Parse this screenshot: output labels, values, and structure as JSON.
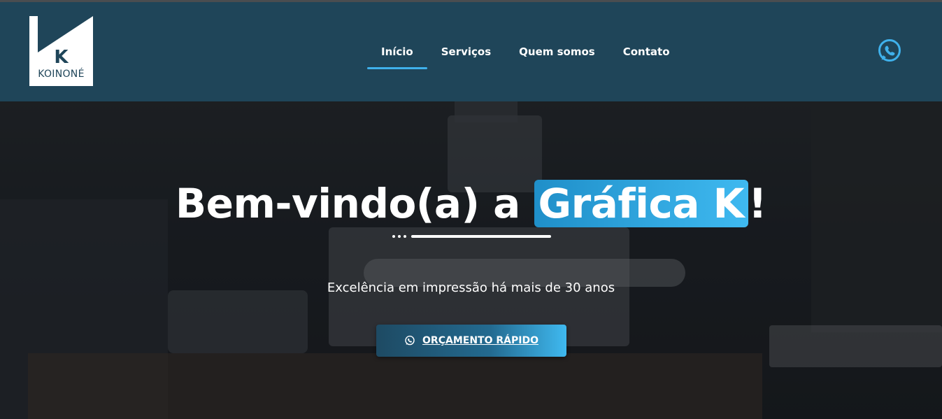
{
  "brand": {
    "logo_letter": "K",
    "logo_name": "KOINONÉ"
  },
  "nav": {
    "items": [
      {
        "label": "Início",
        "active": true
      },
      {
        "label": "Serviços",
        "active": false
      },
      {
        "label": "Quem somos",
        "active": false
      },
      {
        "label": "Contato",
        "active": false
      }
    ]
  },
  "header_icon": "whatsapp-icon",
  "hero": {
    "title_prefix": "Bem-vindo(a) a ",
    "title_highlight": "Gráfica K",
    "title_suffix": "!",
    "subtitle": "Excelência em impressão há mais de 30 anos",
    "cta_label": "ORÇAMENTO RÁPIDO",
    "cta_icon": "whatsapp-icon"
  },
  "colors": {
    "header_bg": "#1f4559",
    "accent": "#3fb1ec",
    "text": "#ffffff"
  }
}
